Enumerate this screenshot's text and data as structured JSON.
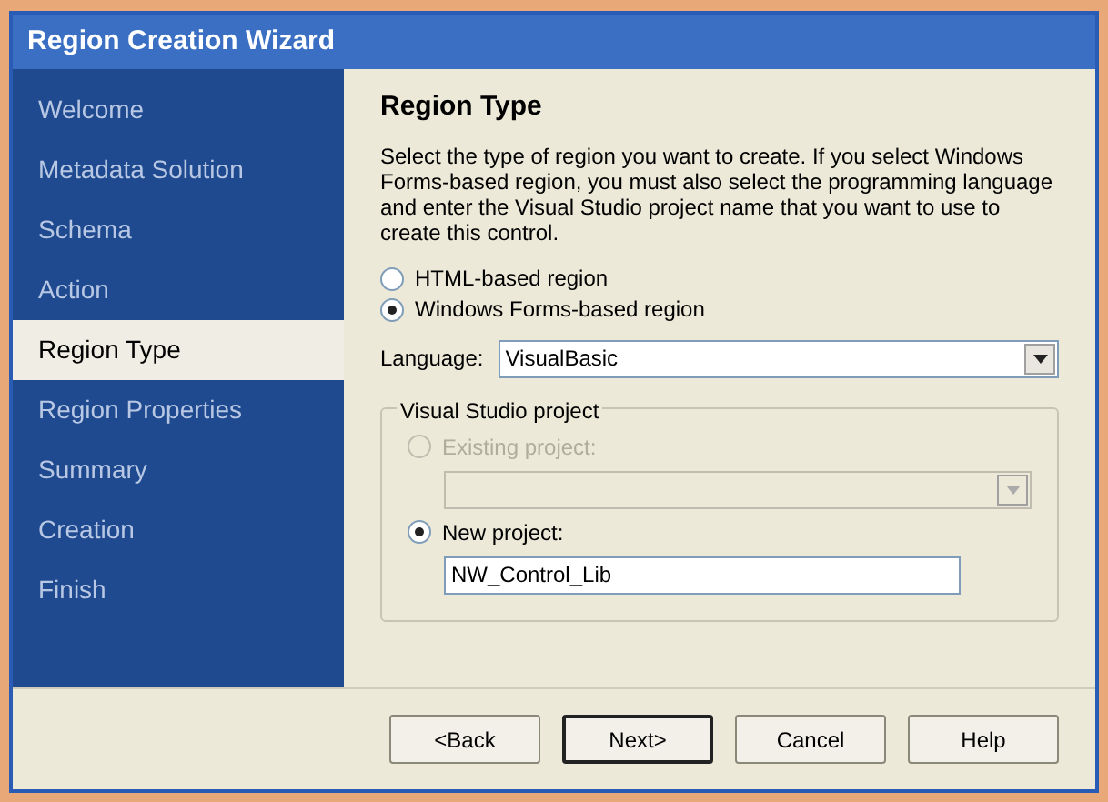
{
  "window": {
    "title": "Region Creation Wizard"
  },
  "steps": [
    {
      "label": "Welcome",
      "selected": false
    },
    {
      "label": "Metadata Solution",
      "selected": false
    },
    {
      "label": "Schema",
      "selected": false
    },
    {
      "label": "Action",
      "selected": false
    },
    {
      "label": "Region Type",
      "selected": true
    },
    {
      "label": "Region Properties",
      "selected": false
    },
    {
      "label": "Summary",
      "selected": false
    },
    {
      "label": "Creation",
      "selected": false
    },
    {
      "label": "Finish",
      "selected": false
    }
  ],
  "page": {
    "heading": "Region Type",
    "description": "Select the type of region you want to create. If you select Windows Forms-based region, you must also select the programming language and enter the Visual Studio project name that you want to use to create this control."
  },
  "region_options": [
    {
      "label": "HTML-based region",
      "selected": false
    },
    {
      "label": "Windows Forms-based region",
      "selected": true
    }
  ],
  "language": {
    "label": "Language:",
    "value": "VisualBasic"
  },
  "project_group": {
    "title": "Visual Studio project",
    "options": [
      {
        "label": "Existing project:",
        "selected": false,
        "disabled": true,
        "kind": "combo"
      },
      {
        "label": "New project:",
        "selected": true,
        "disabled": false,
        "kind": "text",
        "value": "NW_Control_Lib"
      }
    ]
  },
  "buttons": [
    {
      "label": "<Back",
      "default": false
    },
    {
      "label": "Next>",
      "default": true
    },
    {
      "label": "Cancel",
      "default": false
    },
    {
      "label": "Help",
      "default": false
    }
  ]
}
